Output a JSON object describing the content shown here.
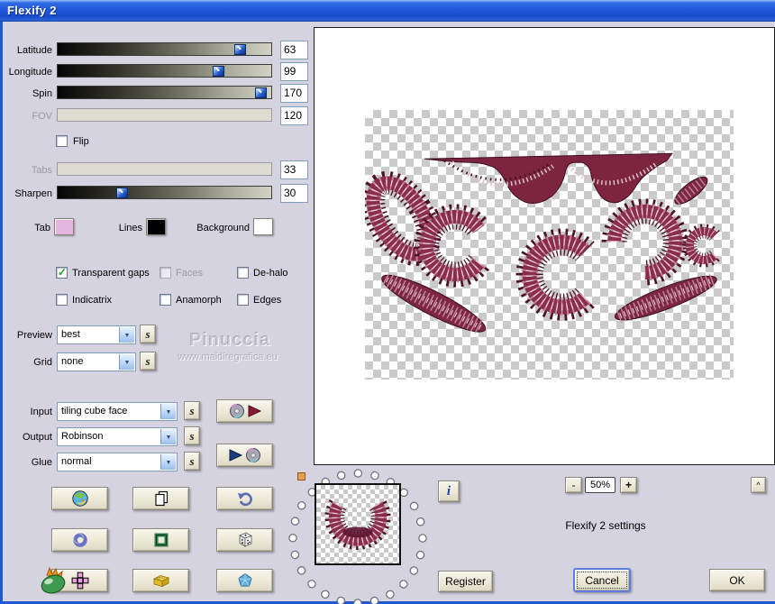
{
  "window": {
    "title": "Flexify 2"
  },
  "sliders": {
    "latitude": {
      "label": "Latitude",
      "value": "63"
    },
    "longitude": {
      "label": "Longitude",
      "value": "99"
    },
    "spin": {
      "label": "Spin",
      "value": "170"
    },
    "fov": {
      "label": "FOV",
      "value": "120"
    },
    "tabs": {
      "label": "Tabs",
      "value": "33"
    },
    "sharpen": {
      "label": "Sharpen",
      "value": "30"
    }
  },
  "flip": {
    "label": "Flip",
    "checked": false
  },
  "colors": {
    "tab": {
      "label": "Tab",
      "swatch": "#e3b5de"
    },
    "lines": {
      "label": "Lines",
      "swatch": "#000000"
    },
    "background": {
      "label": "Background",
      "swatch": "#ffffff"
    }
  },
  "checkboxes": {
    "transparent_gaps": {
      "label": "Transparent gaps",
      "checked": true
    },
    "faces": {
      "label": "Faces",
      "checked": false
    },
    "dehalo": {
      "label": "De-halo",
      "checked": false
    },
    "indicatrix": {
      "label": "Indicatrix",
      "checked": false
    },
    "anamorph": {
      "label": "Anamorph",
      "checked": false
    },
    "edges": {
      "label": "Edges",
      "checked": false
    }
  },
  "dropdowns": {
    "preview": {
      "label": "Preview",
      "value": "best"
    },
    "grid": {
      "label": "Grid",
      "value": "none"
    },
    "input": {
      "label": "Input",
      "value": "tiling cube face"
    },
    "output": {
      "label": "Output",
      "value": "Robinson"
    },
    "glue": {
      "label": "Glue",
      "value": "normal"
    }
  },
  "shuffle_label": "s",
  "watermark": {
    "line1": "Pinuccia",
    "line2": "www.maidiregrafica.eu"
  },
  "info_label": "i",
  "zoom": {
    "minus": "-",
    "level": "50%",
    "plus": "+",
    "collapse": "^"
  },
  "settings_text": "Flexify 2 settings",
  "buttons": {
    "register": "Register",
    "cancel": "Cancel",
    "ok": "OK"
  },
  "accent_colors": {
    "titlebar_blue": "#1e54d6",
    "button_face": "#ece8d6",
    "artwork_maroon": "#7e2743"
  }
}
